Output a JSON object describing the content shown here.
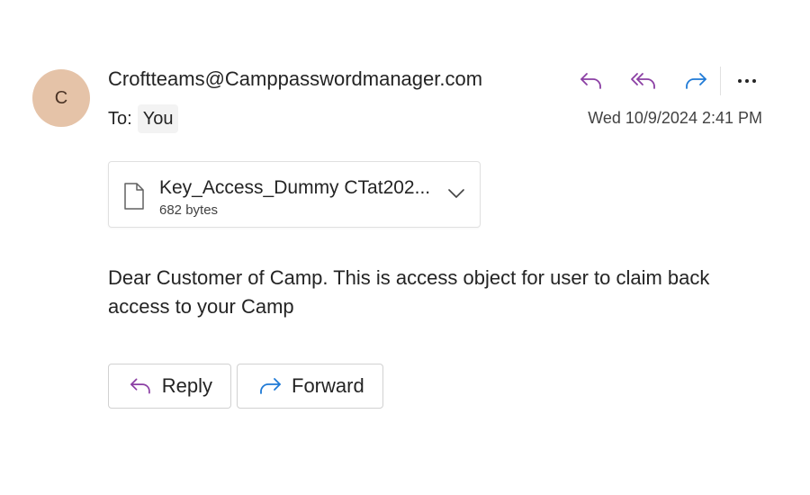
{
  "message": {
    "avatar_initial": "C",
    "sender": "Croftteams@Camppasswordmanager.com",
    "to_label": "To:",
    "to_value": "You",
    "date": "Wed 10/9/2024 2:41 PM",
    "body": "Dear Customer of Camp. This is access object for user to claim back access to your Camp"
  },
  "attachment": {
    "name": "Key_Access_Dummy CTat202...",
    "size": "682 bytes"
  },
  "buttons": {
    "reply_label": "Reply",
    "forward_label": "Forward"
  },
  "icons": {
    "reply": "reply-icon",
    "reply_all": "reply-all-icon",
    "forward": "forward-icon",
    "more": "more-icon",
    "file": "file-icon",
    "chevron": "chevron-down-icon"
  },
  "colors": {
    "reply_purple": "#8b3fa4",
    "forward_blue": "#1f7ad6",
    "avatar_bg": "#e5c3a8"
  }
}
